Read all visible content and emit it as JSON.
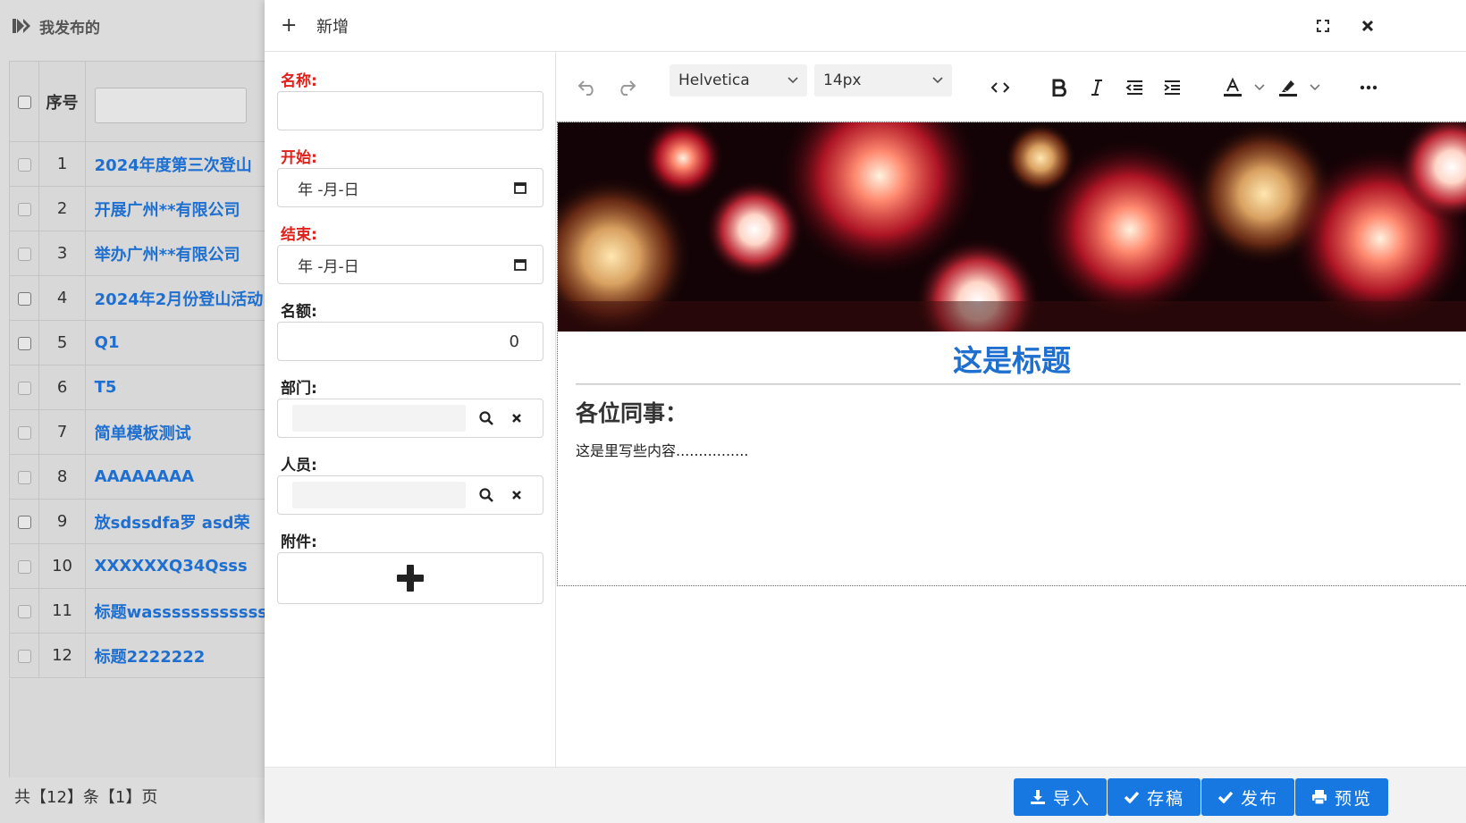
{
  "background_page": {
    "title": "我发布的",
    "table": {
      "header_no": "序号",
      "rows": [
        {
          "no": "1",
          "title": "2024年度第三次登山"
        },
        {
          "no": "2",
          "title": "开展广州**有限公司"
        },
        {
          "no": "3",
          "title": "举办广州**有限公司"
        },
        {
          "no": "4",
          "title": "2024年2月份登山活动"
        },
        {
          "no": "5",
          "title": "Q1"
        },
        {
          "no": "6",
          "title": "T5"
        },
        {
          "no": "7",
          "title": "简单模板测试"
        },
        {
          "no": "8",
          "title": "AAAAAAAA"
        },
        {
          "no": "9",
          "title": "放sdssdfa罗 asd荣"
        },
        {
          "no": "10",
          "title": "XXXXXXQ34Qsss"
        },
        {
          "no": "11",
          "title": "标题wassssssssssss"
        },
        {
          "no": "12",
          "title": "标题2222222"
        }
      ]
    },
    "footer": "共【12】条【1】页"
  },
  "modal": {
    "header": {
      "plus": "+",
      "title": "新增"
    },
    "form": {
      "name_label": "名称:",
      "name_value": "",
      "start_label": "开始:",
      "start_placeholder": "年 -月-日",
      "end_label": "结束:",
      "end_placeholder": "年 -月-日",
      "quota_label": "名额:",
      "quota_value": "0",
      "dept_label": "部门:",
      "person_label": "人员:",
      "attach_label": "附件:"
    },
    "editor": {
      "font_family": "Helvetica",
      "font_size": "14px",
      "doc_title": "这是标题",
      "doc_heading": "各位同事：",
      "doc_body": "这是里写些内容................"
    },
    "footer": {
      "import_label": "导入",
      "draft_label": "存稿",
      "publish_label": "发布",
      "preview_label": "预览"
    },
    "colors": {
      "accent": "#1678e0",
      "required": "#e0201b",
      "title_blue": "#1e6fd0"
    }
  }
}
